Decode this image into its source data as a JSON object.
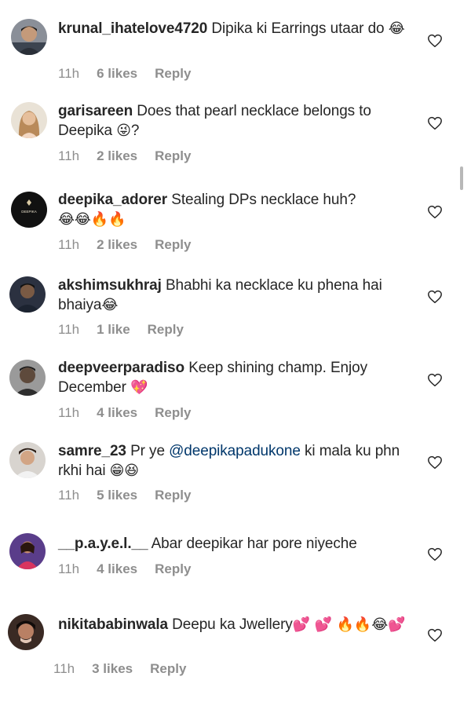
{
  "comments": [
    {
      "username": "krunal_ihatelove4720",
      "text": " Dipika ki Earrings utaar do ",
      "emoji": "😂",
      "time": "11h",
      "likes": "6 likes",
      "reply": "Reply",
      "avatar_icon": "profile-photo-man-icon"
    },
    {
      "username": "garisareen",
      "text": " Does that pearl necklace belongs to Deepika ",
      "emoji": "😜",
      "text_after": "?",
      "time": "11h",
      "likes": "2 likes",
      "reply": "Reply",
      "avatar_icon": "profile-photo-woman-icon"
    },
    {
      "username": "deepika_adorer",
      "text": " Stealing DPs necklace huh?",
      "emoji": "😂😂🔥🔥",
      "time": "11h",
      "likes": "2 likes",
      "reply": "Reply",
      "avatar_icon": "logo-avatar-icon",
      "avatar_logo_text": "DEEPIKA"
    },
    {
      "username": "akshimsukhraj",
      "text": " Bhabhi ka necklace ku phena hai bhaiya",
      "emoji": "😂",
      "time": "11h",
      "likes": "1 like",
      "reply": "Reply",
      "avatar_icon": "profile-photo-man-icon"
    },
    {
      "username": "deepveerparadiso",
      "text": " Keep shining champ. Enjoy December ",
      "emoji": "💖",
      "time": "11h",
      "likes": "4 likes",
      "reply": "Reply",
      "avatar_icon": "profile-photo-man-icon"
    },
    {
      "username": "samre_23",
      "text": " Pr ye ",
      "mention": "@deepikapadukone",
      "text_after": " ki mala ku phn rkhi hai ",
      "emoji": "😁😆",
      "time": "11h",
      "likes": "5 likes",
      "reply": "Reply",
      "avatar_icon": "profile-photo-man-icon"
    },
    {
      "username": "__p.a.y.e.l.__",
      "text": " Abar deepikar har pore niyeche",
      "emoji": "",
      "time": "11h",
      "likes": "4 likes",
      "reply": "Reply",
      "avatar_icon": "profile-photo-woman-icon"
    },
    {
      "username": "nikitababinwala",
      "text": " Deepu ka Jwellery",
      "emoji": "💕 💕 🔥🔥😂💕",
      "time": "11h",
      "likes": "3 likes",
      "reply": "Reply",
      "avatar_icon": "profile-photo-woman-icon"
    }
  ],
  "like_icon": "heart-outline-icon",
  "colors": {
    "text": "#262626",
    "meta": "#8e8e8e",
    "mention": "#00376b"
  }
}
